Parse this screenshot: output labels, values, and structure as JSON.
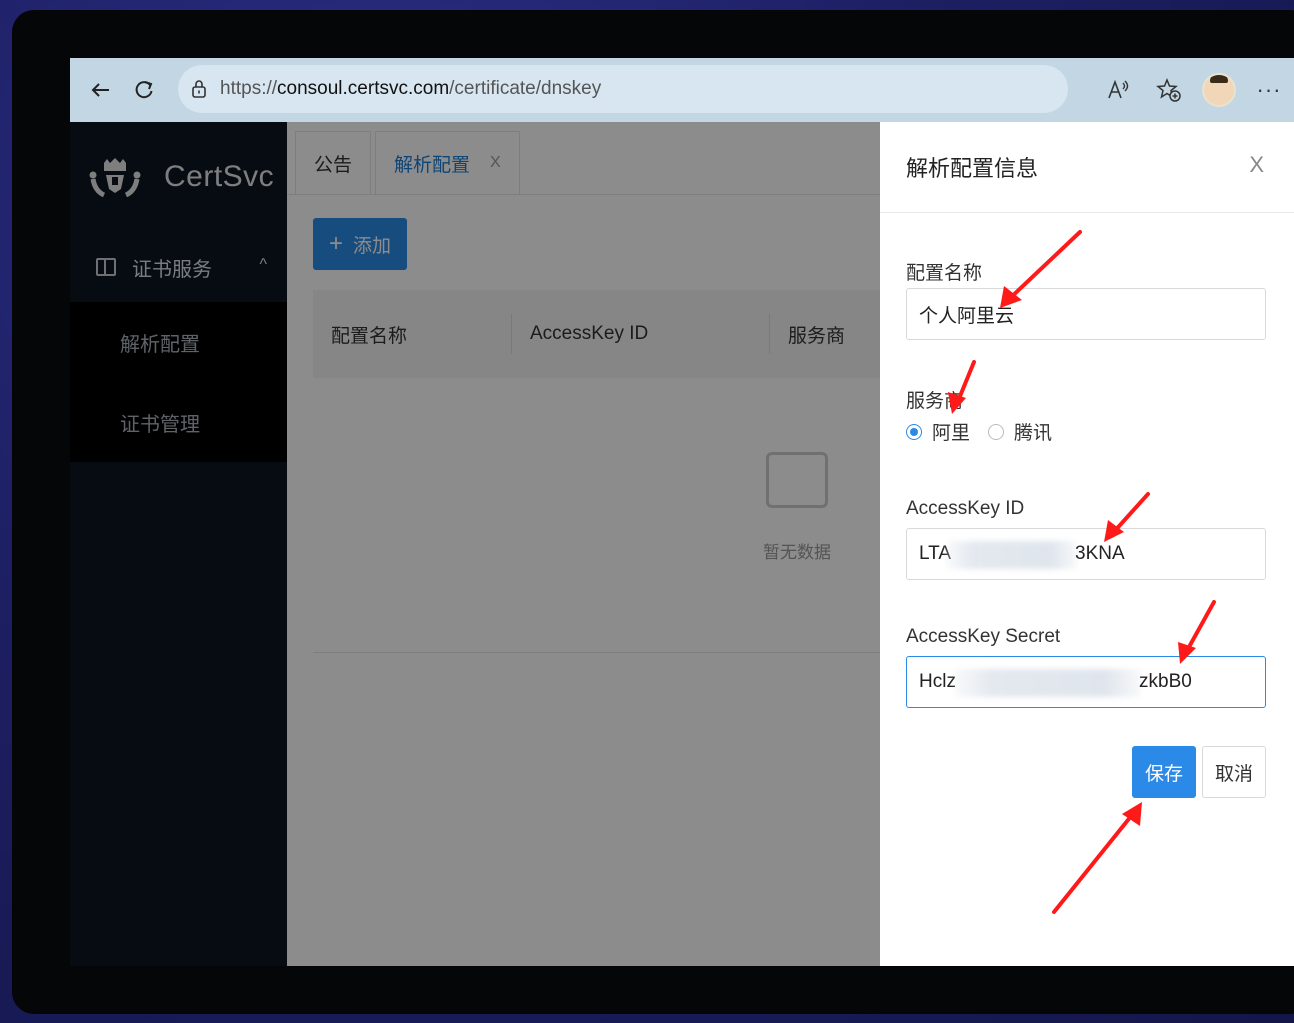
{
  "browser": {
    "url_prefix": "https://",
    "url_host": "consoul.certsvc.com",
    "url_path": "/certificate/dnskey"
  },
  "sidebar": {
    "logo": "CertSvc",
    "group_label": "证书服务",
    "items": [
      {
        "label": "解析配置"
      },
      {
        "label": "证书管理"
      }
    ]
  },
  "tabs": [
    {
      "label": "公告"
    },
    {
      "label": "解析配置",
      "close": "X"
    }
  ],
  "toolbar": {
    "add_label": "添加",
    "add_icon": "+"
  },
  "table": {
    "columns": [
      "配置名称",
      "AccessKey ID",
      "服务商"
    ],
    "empty_text": "暂无数据"
  },
  "drawer": {
    "title": "解析配置信息",
    "close": "X",
    "name_label": "配置名称",
    "name_value": "个人阿里云",
    "provider_label": "服务商",
    "provider_options": [
      "阿里",
      "腾讯"
    ],
    "provider_selected": "阿里",
    "ak_id_label": "AccessKey ID",
    "ak_id_start": "LTA",
    "ak_id_end": "3KNA",
    "ak_secret_label": "AccessKey Secret",
    "ak_secret_start": "Hclz",
    "ak_secret_end": "zkbB0",
    "save_label": "保存",
    "cancel_label": "取消"
  },
  "colors": {
    "primary": "#2b8ae8",
    "sidebar": "#0b1622",
    "annotation_arrow": "#ff1a1a"
  }
}
